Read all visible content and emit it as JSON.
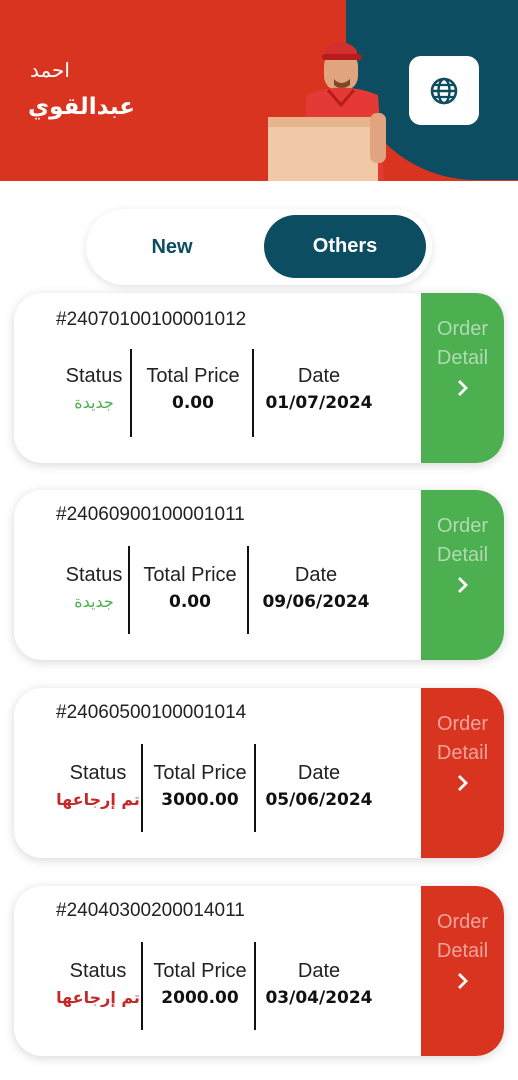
{
  "colors": {
    "header_red": "#d9341f",
    "teal": "#0c4d61",
    "green": "#4caf50",
    "red_btn": "#d9341f",
    "status_green": "#4caf50",
    "status_red": "#c62828"
  },
  "header": {
    "user_first": "احمد",
    "user_last": "عبدالقوي",
    "language_icon": "globe-icon"
  },
  "tabs": {
    "new_label": "New",
    "others_label": "Others",
    "active": "Others"
  },
  "orders": [
    {
      "number": "#24070100100001012",
      "status_label": "Status",
      "status": "جديدة",
      "status_kind": "new",
      "price_label": "Total Price",
      "price": "0.00",
      "date_label": "Date",
      "date": "01/07/2024",
      "detail_line1": "Order",
      "detail_line2": "Detail"
    },
    {
      "number": "#24060900100001011",
      "status_label": "Status",
      "status": "جديدة",
      "status_kind": "new",
      "price_label": "Total Price",
      "price": "0.00",
      "date_label": "Date",
      "date": "09/06/2024",
      "detail_line1": "Order",
      "detail_line2": "Detail"
    },
    {
      "number": "#24060500100001014",
      "status_label": "Status",
      "status": "تم إرجاعها",
      "status_kind": "returned",
      "price_label": "Total Price",
      "price": "3000.00",
      "date_label": "Date",
      "date": "05/06/2024",
      "detail_line1": "Order",
      "detail_line2": "Detail"
    },
    {
      "number": "#24040300200014011",
      "status_label": "Status",
      "status": "تم إرجاعها",
      "status_kind": "returned",
      "price_label": "Total Price",
      "price": "2000.00",
      "date_label": "Date",
      "date": "03/04/2024",
      "detail_line1": "Order",
      "detail_line2": "Detail"
    }
  ]
}
